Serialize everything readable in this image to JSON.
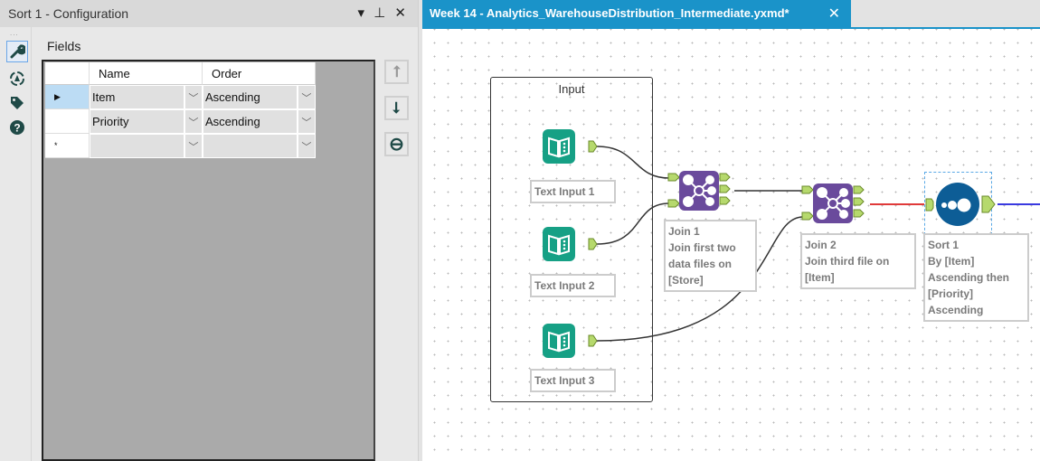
{
  "config_panel": {
    "title": "Sort 1 - Configuration",
    "controls": "▾ ⊥ ✕",
    "side_dots": "...",
    "side_icons": [
      "wrench-icon",
      "target-icon",
      "tag-icon",
      "help-icon"
    ],
    "fields_label": "Fields",
    "columns": [
      "Name",
      "Order"
    ],
    "rows": [
      {
        "marker": "▶",
        "name": "Item",
        "order": "Ascending"
      },
      {
        "marker": "",
        "name": "Priority",
        "order": "Ascending"
      },
      {
        "marker": "*",
        "name": "",
        "order": ""
      }
    ],
    "buttons": {
      "up": "⭡",
      "down": "⭣",
      "remove": "⊖"
    }
  },
  "workflow_tab": {
    "title": "Week 14 - Analytics_WarehouseDistribution_Intermediate.yxmd*",
    "close": "✕"
  },
  "canvas": {
    "container_title": "Input",
    "tools": [
      {
        "id": "text-input-1",
        "label": "Text Input 1"
      },
      {
        "id": "text-input-2",
        "label": "Text Input 2"
      },
      {
        "id": "text-input-3",
        "label": "Text Input 3"
      }
    ],
    "join1": {
      "lines": [
        "Join 1",
        "Join first two",
        "data files on",
        "[Store]"
      ]
    },
    "join2": {
      "lines": [
        "Join 2",
        "Join third file on",
        "[Item]"
      ]
    },
    "sort1": {
      "lines": [
        "Sort 1",
        "By [Item]",
        "Ascending then",
        "[Priority]",
        "Ascending"
      ]
    },
    "anchors": {
      "left": "L",
      "right": "R",
      "join": "J"
    }
  },
  "colors": {
    "tab_accent": "#1a93c9",
    "text_input_teal": "#16a085",
    "join_purple": "#6a4a9c",
    "sort_blue": "#0d5d96",
    "anchor_green": "#b6d96d",
    "wire_red": "#e03a3a",
    "wire_blue": "#3a3ae0"
  }
}
